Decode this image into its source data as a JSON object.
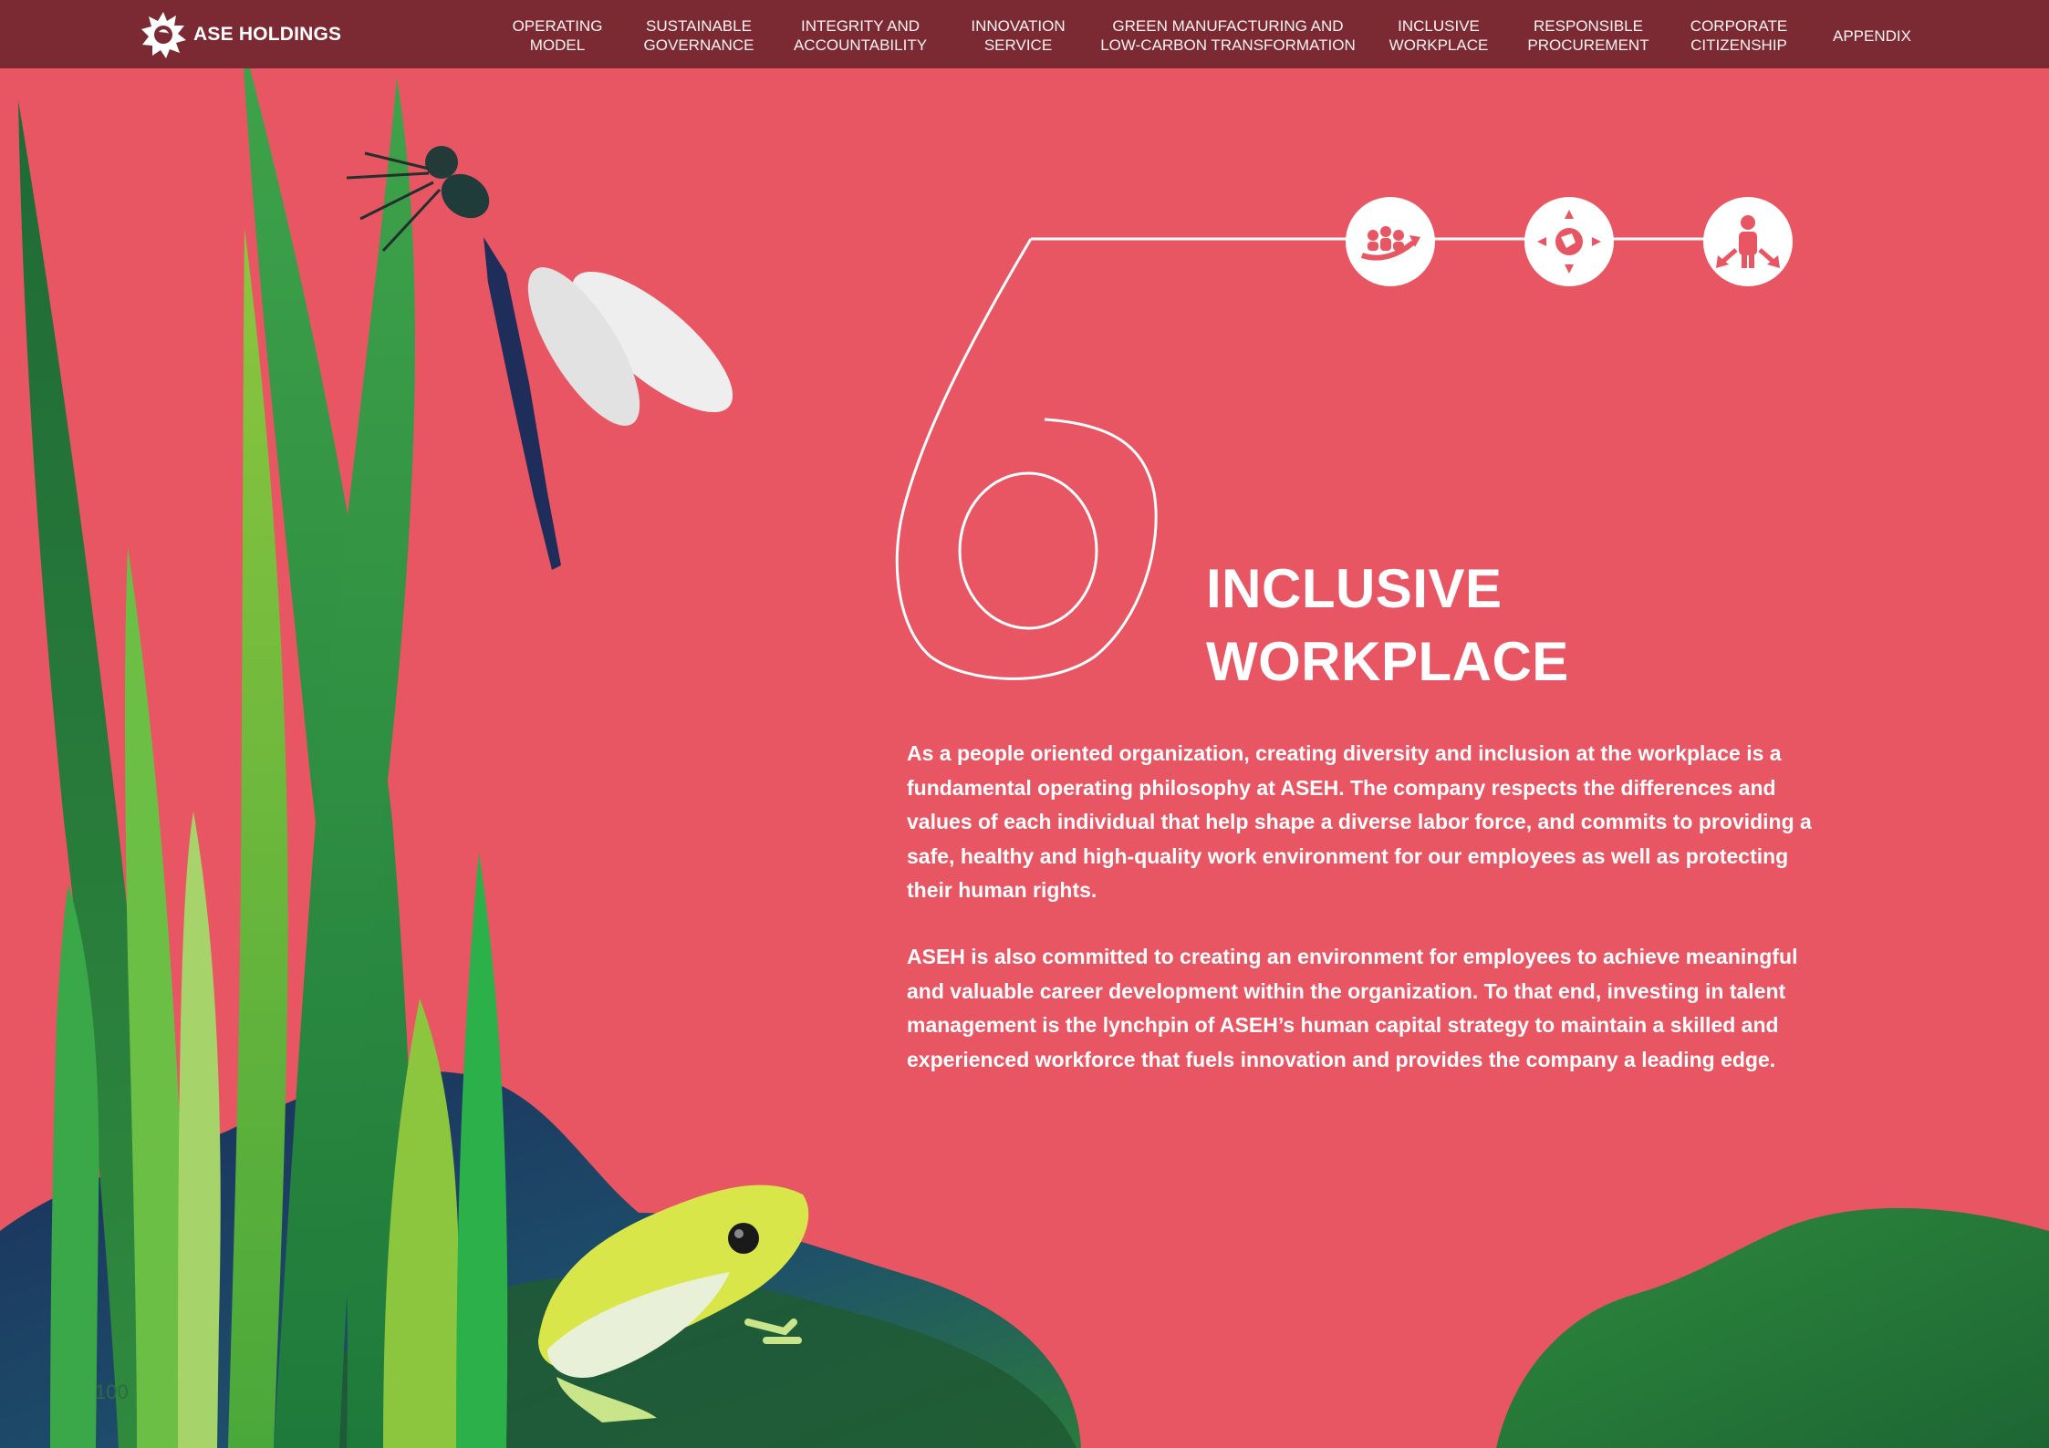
{
  "brand": {
    "name": "ASE HOLDINGS",
    "logo_icon": "sun-logo-icon"
  },
  "nav": [
    {
      "label": "OPERATING\nMODEL"
    },
    {
      "label": "SUSTAINABLE\nGOVERNANCE"
    },
    {
      "label": "INTEGRITY AND\nACCOUNTABILITY"
    },
    {
      "label": "INNOVATION\nSERVICE"
    },
    {
      "label": "GREEN MANUFACTURING AND\nLOW-CARBON TRANSFORMATION"
    },
    {
      "label": "INCLUSIVE\nWORKPLACE"
    },
    {
      "label": "RESPONSIBLE\nPROCUREMENT"
    },
    {
      "label": "CORPORATE\nCITIZENSHIP"
    },
    {
      "label": "APPENDIX"
    }
  ],
  "chapter": {
    "number": "6",
    "title_line1": "INCLUSIVE",
    "title_line2": "WORKPLACE",
    "icons": [
      "team-growth-icon",
      "globe-arrows-icon",
      "person-arrows-icon"
    ]
  },
  "body": {
    "paragraph1": "As a people oriented organization, creating diversity and inclusion at the workplace is a fundamental operating philosophy at ASEH. The company respects the differences and values of each individual that help shape a diverse labor force, and commits to providing a safe, healthy and high-quality work environment for our employees as well as protecting their human rights.",
    "paragraph2": "ASEH is also committed to creating an environment for employees to achieve meaningful and valuable career development within the organization. To that end, investing in talent management is the lynchpin of ASEH’s human capital strategy to maintain a skilled and experienced workforce that fuels innovation and provides the company a leading edge."
  },
  "page_number": "100",
  "colors": {
    "background": "#e85563",
    "topbar": "#7b2a33",
    "text": "#ffffff"
  }
}
